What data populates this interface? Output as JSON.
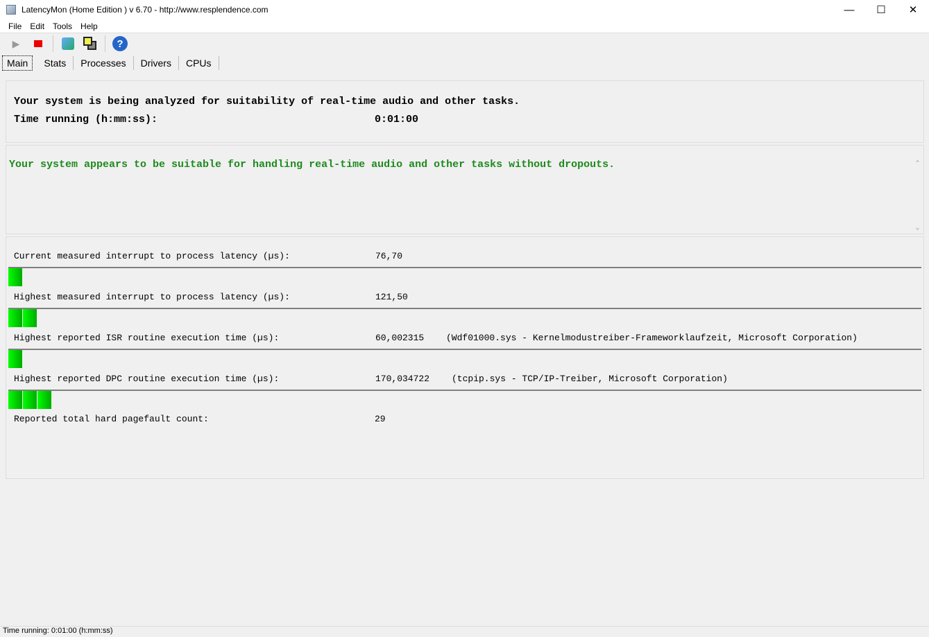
{
  "window": {
    "title": "LatencyMon  (Home Edition )  v 6.70 - http://www.resplendence.com"
  },
  "menu": [
    "File",
    "Edit",
    "Tools",
    "Help"
  ],
  "tabs": [
    "Main",
    "Stats",
    "Processes",
    "Drivers",
    "CPUs"
  ],
  "header": {
    "line1": "Your system is being analyzed for suitability of real-time audio and other tasks.",
    "time_label": "Time running (h:mm:ss):",
    "time_value": "0:01:00"
  },
  "verdict": {
    "text": "Your system appears to be suitable for handling real-time audio and other tasks without dropouts.",
    "color": "#1e8a1e"
  },
  "metrics": [
    {
      "label": "Current measured interrupt to process latency (µs):",
      "value": "76,70",
      "detail": "",
      "bar_percent": 1.5
    },
    {
      "label": "Highest measured interrupt to process latency (µs):",
      "value": "121,50",
      "detail": "",
      "bar_percent": 3
    },
    {
      "label": "Highest reported ISR routine execution time (µs):",
      "value": "60,002315",
      "detail": "(Wdf01000.sys - Kernelmodustreiber-Frameworklaufzeit, Microsoft Corporation)",
      "bar_percent": 1.5
    },
    {
      "label": "Highest reported DPC routine execution time (µs):",
      "value": "170,034722",
      "detail": "(tcpip.sys - TCP/IP-Treiber, Microsoft Corporation)",
      "bar_percent": 5
    }
  ],
  "pagefault": {
    "label": "Reported total hard pagefault count:",
    "value": "29"
  },
  "status": "Time running: 0:01:00  (h:mm:ss)"
}
